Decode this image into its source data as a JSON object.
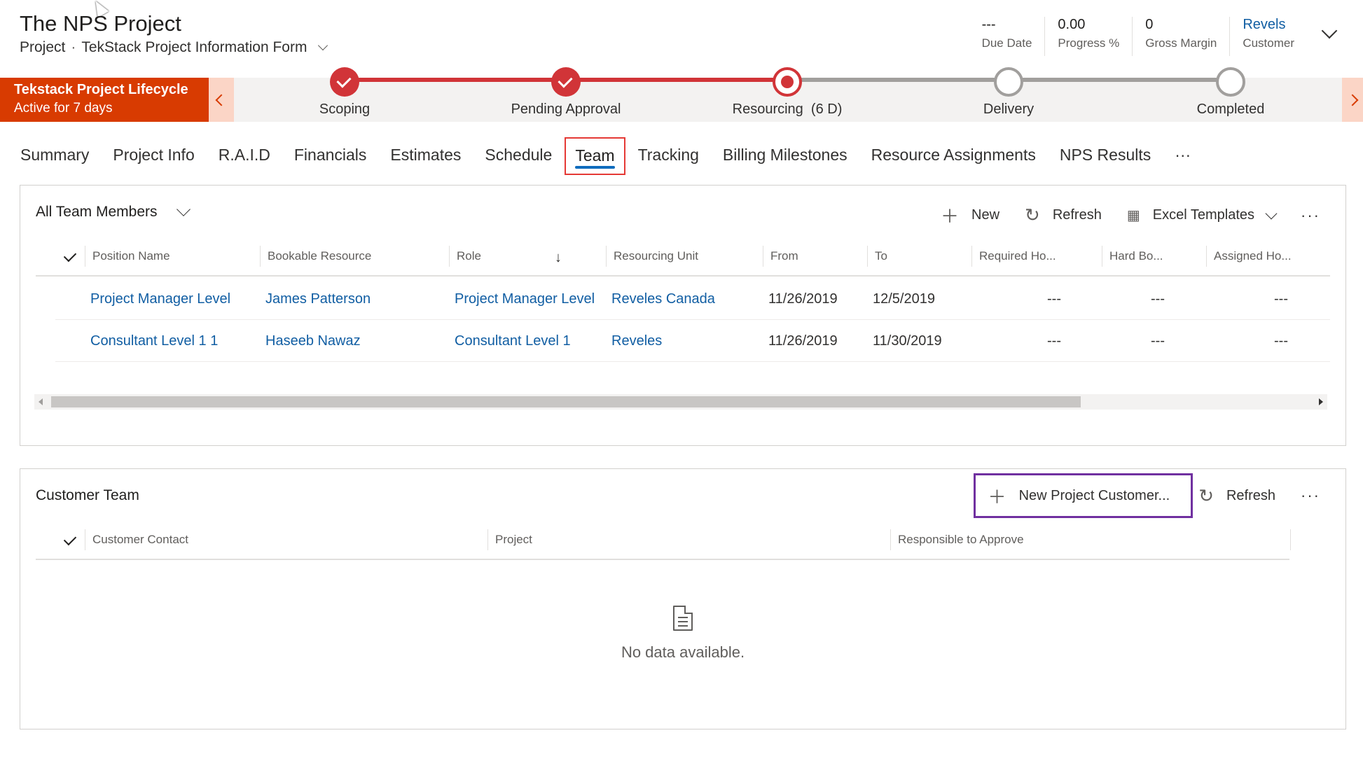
{
  "header": {
    "title": "The NPS Project",
    "entity": "Project",
    "separator": "·",
    "form_name": "TekStack Project Information Form",
    "kpis": [
      {
        "value": "---",
        "label": "Due Date"
      },
      {
        "value": "0.00",
        "label": "Progress %"
      },
      {
        "value": "0",
        "label": "Gross Margin"
      },
      {
        "value": "Revels",
        "label": "Customer"
      }
    ]
  },
  "bpf": {
    "name": "Tekstack Project Lifecycle",
    "status": "Active for 7 days",
    "stages": [
      {
        "label": "Scoping",
        "state": "done"
      },
      {
        "label": "Pending Approval",
        "state": "done"
      },
      {
        "label": "Resourcing  (6 D)",
        "state": "active"
      },
      {
        "label": "Delivery",
        "state": "todo"
      },
      {
        "label": "Completed",
        "state": "todo"
      }
    ],
    "colors": {
      "accent": "#d83b01",
      "stage": "#d13438",
      "inactive": "#a19f9d"
    }
  },
  "tabs": [
    {
      "label": "Summary"
    },
    {
      "label": "Project Info"
    },
    {
      "label": "R.A.I.D"
    },
    {
      "label": "Financials"
    },
    {
      "label": "Estimates"
    },
    {
      "label": "Schedule"
    },
    {
      "label": "Team",
      "selected": true
    },
    {
      "label": "Tracking"
    },
    {
      "label": "Billing Milestones"
    },
    {
      "label": "Resource Assignments"
    },
    {
      "label": "NPS Results"
    },
    {
      "label": "···"
    }
  ],
  "team_grid": {
    "view_name": "All Team Members",
    "commands": {
      "new": "New",
      "refresh": "Refresh",
      "excel": "Excel Templates",
      "more": "···"
    },
    "columns": [
      "Position Name",
      "Bookable Resource",
      "Role",
      "Resourcing Unit",
      "From",
      "To",
      "Required Ho...",
      "Hard Bo...",
      "Assigned Ho..."
    ],
    "rows": [
      [
        "Project Manager Level",
        "James Patterson",
        "Project Manager Level",
        "Reveles Canada",
        "11/26/2019",
        "12/5/2019",
        "---",
        "---",
        "---"
      ],
      [
        "Consultant Level 1 1",
        "Haseeb Nawaz",
        "Consultant Level 1",
        "Reveles",
        "11/26/2019",
        "11/30/2019",
        "---",
        "---",
        "---"
      ]
    ],
    "sort_icon": "arrow-down-icon"
  },
  "customer_grid": {
    "title": "Customer Team",
    "commands": {
      "new": "New Project Customer...",
      "refresh": "Refresh",
      "more": "···"
    },
    "columns": [
      "Customer Contact",
      "Project",
      "Responsible to Approve"
    ],
    "empty_text": "No data available.",
    "highlight_color": "#7030a0"
  },
  "tab_highlight_color": "#e53935",
  "link_color": "#115ea3"
}
